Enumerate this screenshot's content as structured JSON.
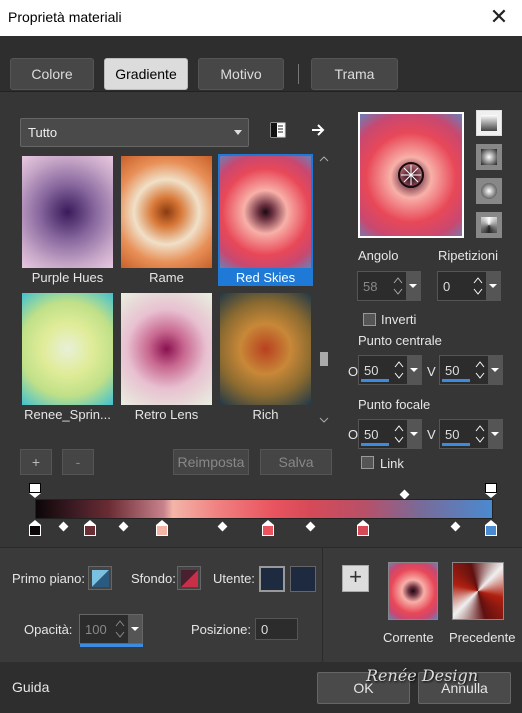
{
  "window": {
    "title": "Proprietà materiali",
    "close": "✕"
  },
  "tabs": [
    {
      "label": "Colore",
      "selected": false
    },
    {
      "label": "Gradiente",
      "selected": true
    },
    {
      "label": "Motivo",
      "selected": false
    },
    {
      "label": "Trama",
      "selected": false
    }
  ],
  "category": {
    "value": "Tutto"
  },
  "gradients": [
    {
      "name": "Purple Hues",
      "colors": [
        "#3a1a5a",
        "#8a6aa0",
        "#e8c8e0"
      ]
    },
    {
      "name": "Rame",
      "colors": [
        "#8a3a10",
        "#f0e0c8",
        "#d87838"
      ]
    },
    {
      "name": "Red Skies",
      "colors": [
        "#1a0a10",
        "#f8b0a8",
        "#e84858",
        "#6a80b8"
      ],
      "selected": true
    },
    {
      "name": "Renee_Sprin...",
      "colors": [
        "#e8f0d8",
        "#d8e880",
        "#40c0d0"
      ]
    },
    {
      "name": "Retro Lens",
      "colors": [
        "#8a1050",
        "#e8c0d0",
        "#e8f0e0"
      ]
    },
    {
      "name": "Rich",
      "colors": [
        "#b84020",
        "#b89040",
        "#203848"
      ]
    }
  ],
  "actions": {
    "add": "+",
    "remove": "-",
    "reset": "Reimposta",
    "save": "Salva"
  },
  "preview": {
    "colors": [
      "#1a0a10",
      "#f8b0a8",
      "#e84858",
      "#6a80b8"
    ]
  },
  "angle": {
    "label": "Angolo",
    "value": "58"
  },
  "repeats": {
    "label": "Ripetizioni",
    "value": "0"
  },
  "invert": {
    "label": "Inverti",
    "checked": false
  },
  "center": {
    "label": "Punto centrale",
    "o_label": "O",
    "o_value": "50",
    "v_label": "V",
    "v_value": "50"
  },
  "focal": {
    "label": "Punto focale",
    "o_label": "O",
    "o_value": "50",
    "v_label": "V",
    "v_value": "50"
  },
  "link": {
    "label": "Link",
    "checked": false
  },
  "foreground": {
    "label": "Primo piano:"
  },
  "background": {
    "label": "Sfondo:"
  },
  "user": {
    "label": "Utente:"
  },
  "opacity": {
    "label": "Opacità:",
    "value": "100"
  },
  "position": {
    "label": "Posizione:",
    "value": "0"
  },
  "current": {
    "label": "Corrente"
  },
  "previous": {
    "label": "Precedente"
  },
  "footer": {
    "help": "Guida",
    "ok": "OK",
    "cancel": "Annulla",
    "watermark": "Renée Design"
  }
}
